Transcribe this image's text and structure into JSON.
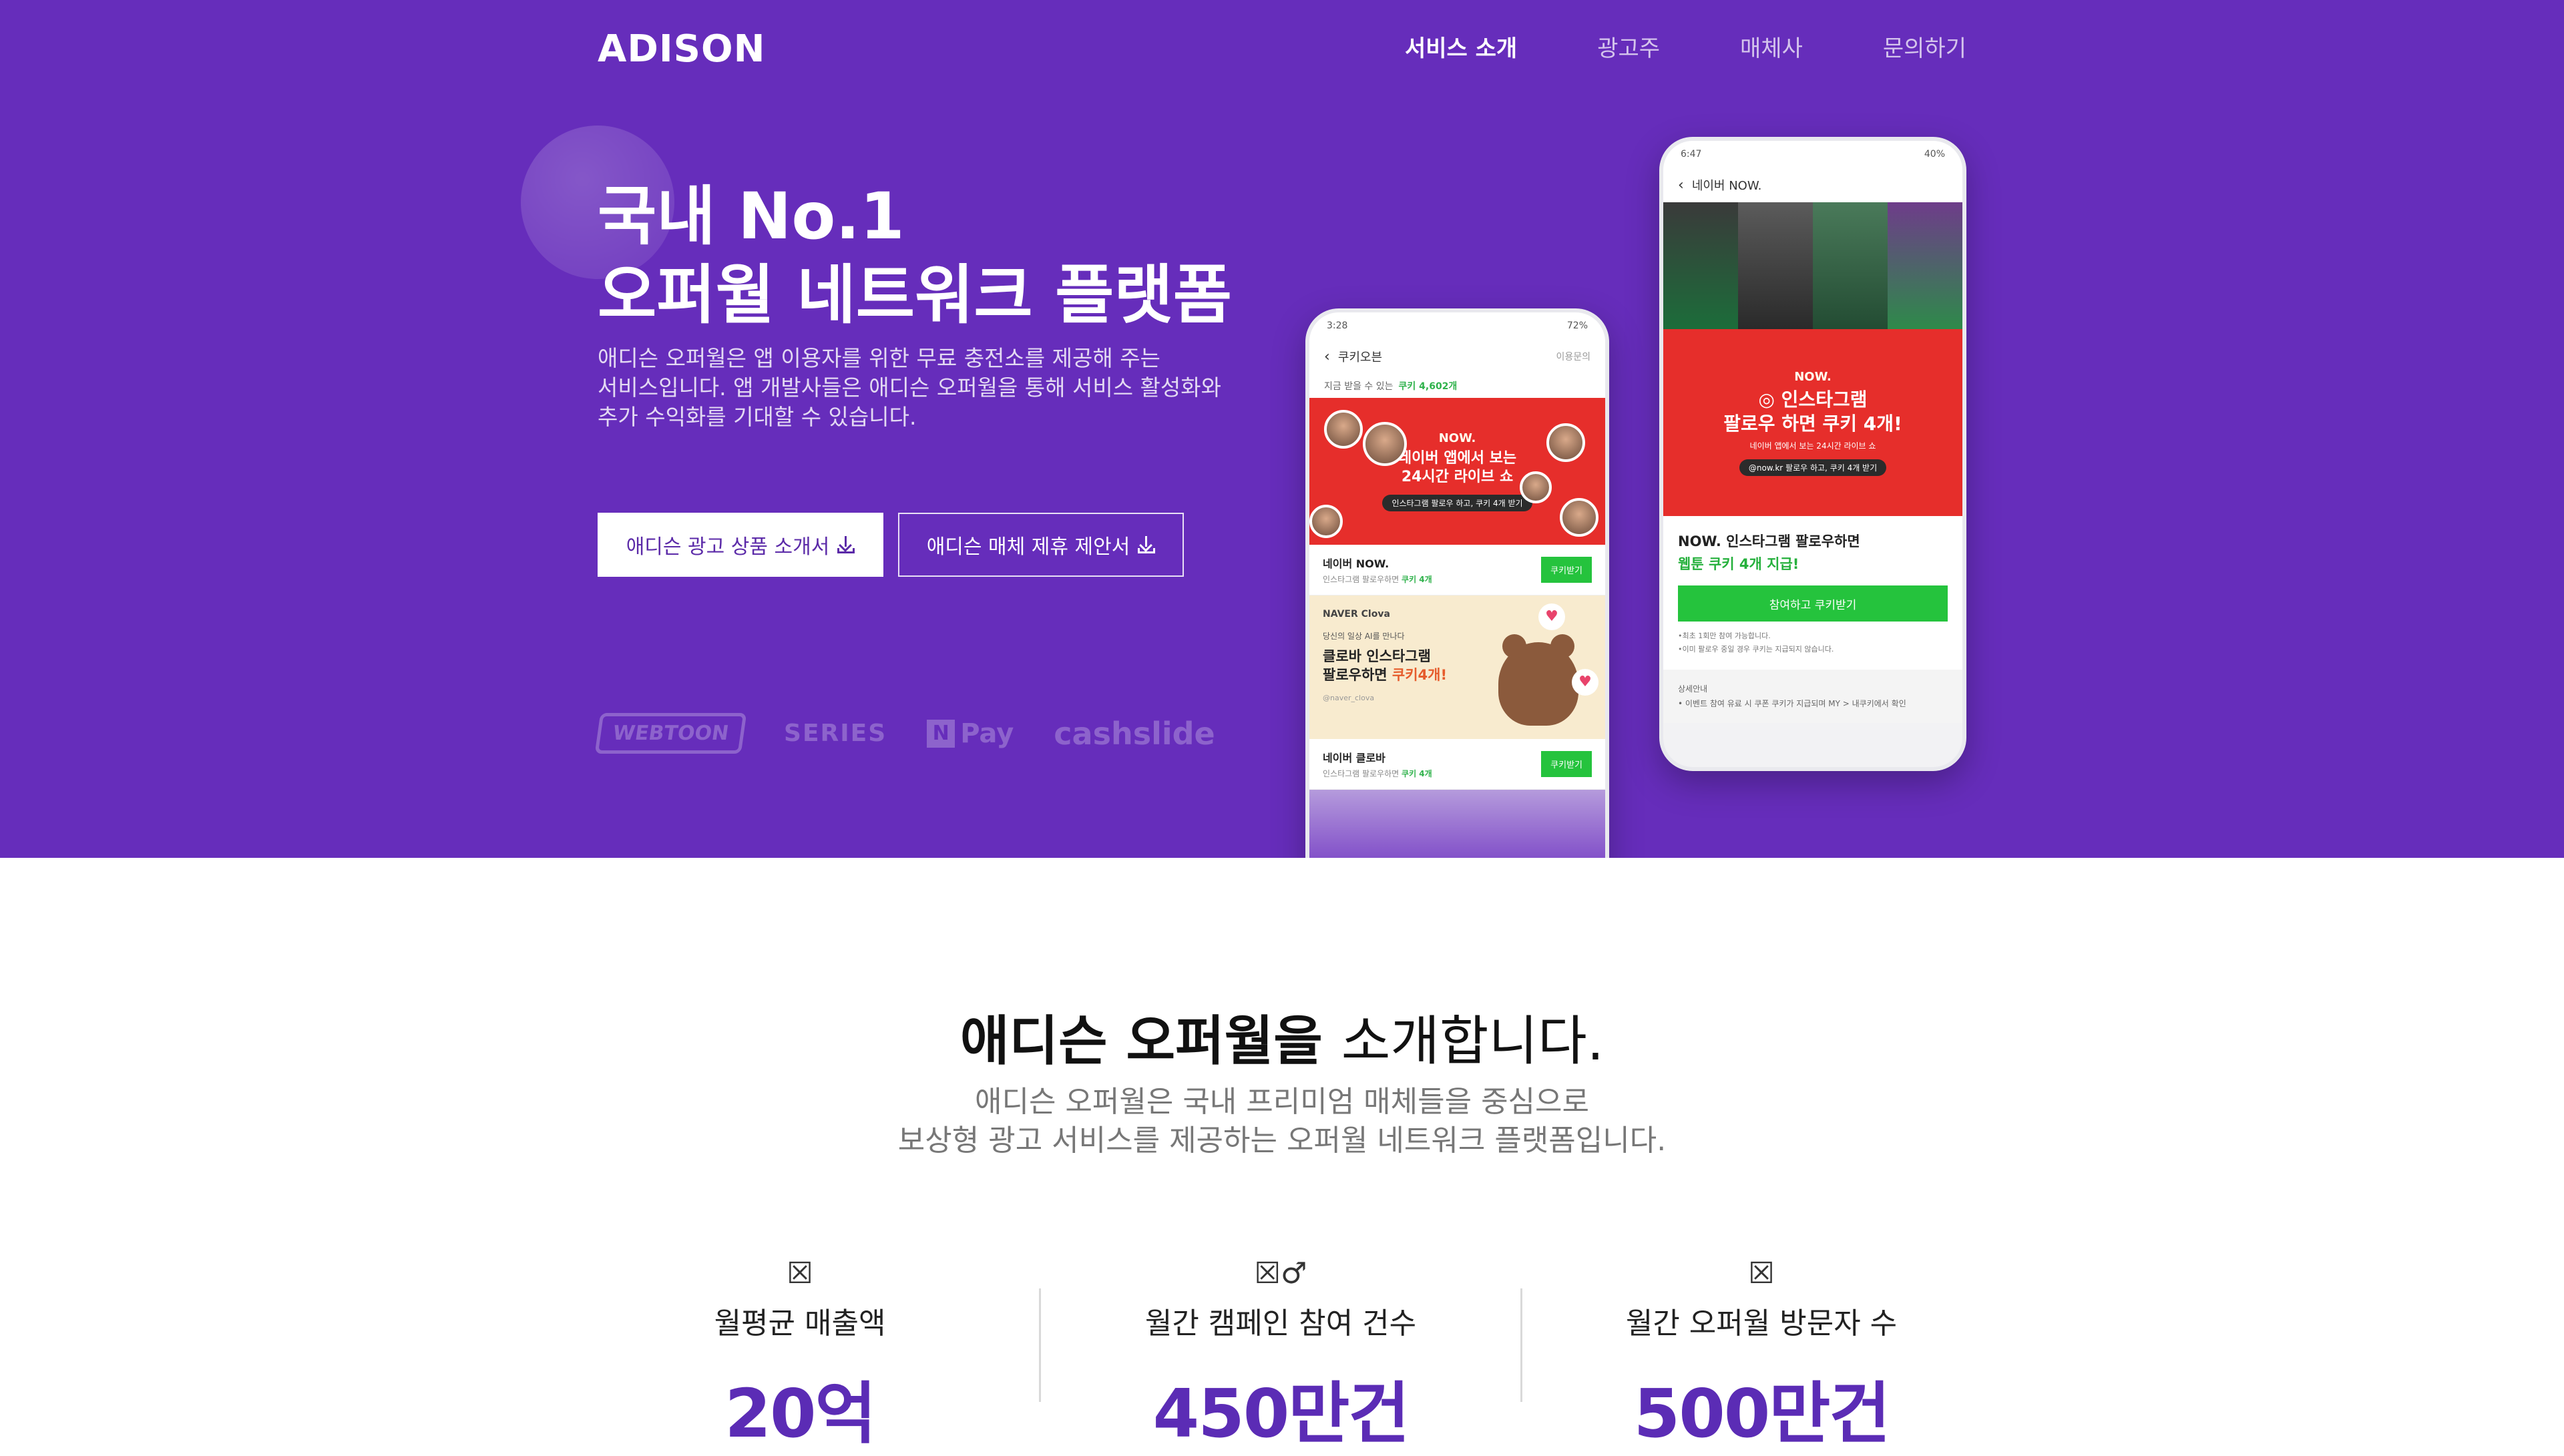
{
  "header": {
    "logo": "ADISON",
    "nav": [
      {
        "label": "서비스 소개"
      },
      {
        "label": "광고주"
      },
      {
        "label": "매체사"
      },
      {
        "label": "문의하기"
      }
    ]
  },
  "hero": {
    "title_line1": "국내 No.1",
    "title_line2": "오퍼월 네트워크 플랫폼",
    "desc_line1": "애디슨 오퍼월은 앱 이용자를 위한 무료 충전소를 제공해 주는",
    "desc_line2": "서비스입니다. 앱 개발사들은 애디슨 오퍼월을 통해 서비스 활성화와",
    "desc_line3": "추가 수익화를 기대할 수 있습니다.",
    "btn_ad_label": "애디슨 광고 상품 소개서",
    "btn_media_label": "애디슨 매체 제휴 제안서",
    "partners": {
      "webtoon": "WEBTOON",
      "series": "SERIES",
      "npay_mark": "N",
      "npay": "Pay",
      "cashslide": "cashslide"
    }
  },
  "phone_left": {
    "status_time": "3:28",
    "status_right": "72%",
    "topbar_title": "쿠키오븐",
    "topbar_right": "이용문의",
    "sub_text": "지금 받을 수 있는",
    "sub_count": "쿠키 4,602개",
    "promo1_brand": "NOW.",
    "promo1_main_1": "네이버 앱에서 보는",
    "promo1_main_2": "24시간 라이브 쇼",
    "promo1_pill": "인스타그램 팔로우 하고, 쿠키 4개 받기",
    "row1_title": "네이버 NOW.",
    "row1_sub": "인스타그램 팔로우하면",
    "row1_reward": "쿠키 4개",
    "row_btn": "쿠키받기",
    "promo2_brand": "NAVER Clova",
    "promo2_small": "당신의 일상 AI를 만나다",
    "promo2_main_1": "클로바 인스타그램",
    "promo2_main_2": "팔로우하면",
    "promo2_reward": "쿠키4개!",
    "promo2_handle": "@naver_clova",
    "row2_title": "네이버 클로바",
    "row2_sub": "인스타그램 팔로우하면",
    "row2_reward": "쿠키 4개",
    "heart_glyph": "♥"
  },
  "phone_right": {
    "status_time": "6:47",
    "status_right": "40%",
    "topbar_title": "네이버 NOW.",
    "promo_brand": "NOW.",
    "promo_main_1": "인스타그램",
    "promo_main_2": "팔로우 하면 쿠키 4개!",
    "promo_small": "네이버 앱에서 보는 24시간 라이브 쇼",
    "promo_pill": "@now.kr 팔로우 하고, 쿠키 4개 받기",
    "info_title": "NOW. 인스타그램 팔로우하면",
    "info_reward": "웹툰 쿠키 4개 지급!",
    "cta_label": "참여하고 쿠키받기",
    "note_1": "•최초 1회만 참여 가능합니다.",
    "note_2": "•이미 팔로우 중일 경우 쿠키는 지급되지 않습니다.",
    "detail_title": "상세안내",
    "detail_text": "• 이벤트 참여 유료 시 쿠폰 쿠키가 지급되며 MY > 내쿠키에서 확인"
  },
  "intro": {
    "title_bold": "애디슨 오퍼월을",
    "title_light": "소개합니다.",
    "desc_line1": "애디슨 오퍼월은 국내 프리미엄 매체들을 중심으로",
    "desc_line2": "보상형 광고 서비스를 제공하는 오퍼월 네트워크 플랫폼입니다."
  },
  "stats": [
    {
      "icon": "☒",
      "label": "월평균 매출액",
      "value": "20억"
    },
    {
      "icon": "☒♂",
      "label": "월간 캠페인 참여 건수",
      "value": "450만건"
    },
    {
      "icon": "☒",
      "label": "월간 오퍼월 방문자 수",
      "value": "500만건"
    }
  ],
  "colors": {
    "hero_bg": "#662dbb",
    "stat_value": "#5b2cb5",
    "cta_green": "#25c33d",
    "promo_red": "#e62e2b"
  }
}
